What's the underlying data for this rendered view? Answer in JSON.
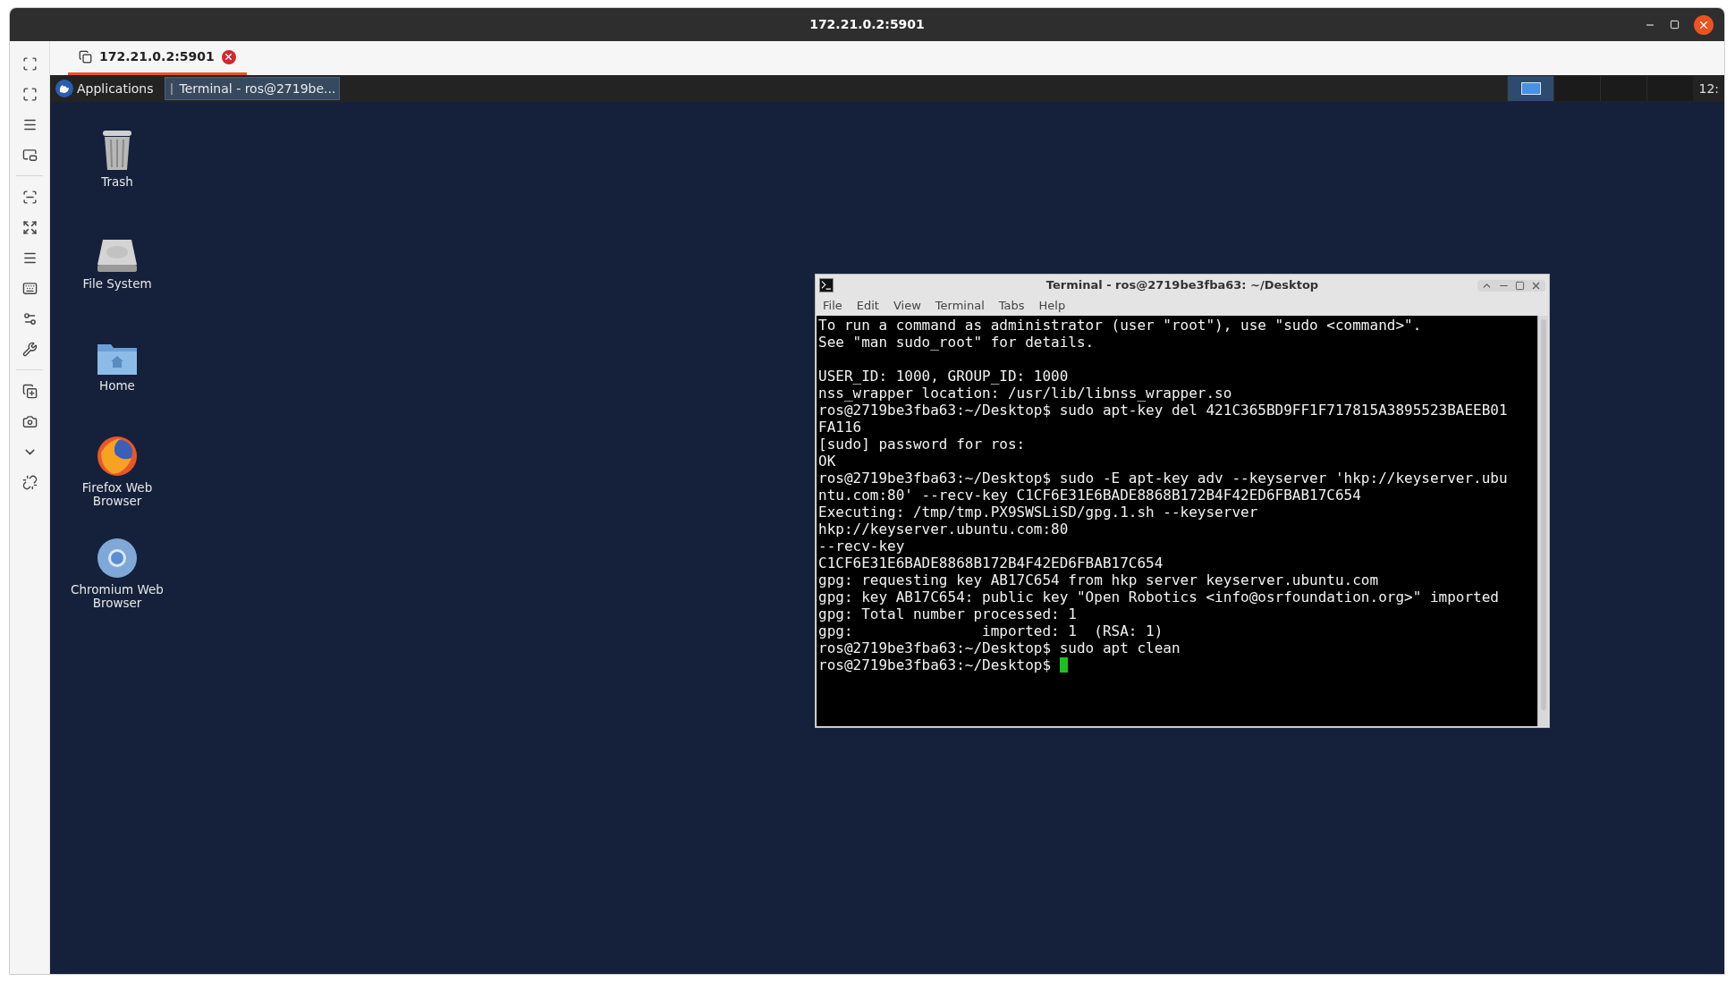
{
  "window": {
    "title": "172.21.0.2:5901"
  },
  "tabs": [
    {
      "label": "172.21.0.2:5901",
      "selected": true
    }
  ],
  "panel": {
    "applications_label": "Applications",
    "tasks": [
      {
        "label": "Terminal - ros@2719be...",
        "selected": true
      }
    ],
    "workspaces": [
      {
        "selected": true
      },
      {
        "selected": false
      },
      {
        "selected": false
      },
      {
        "selected": false
      }
    ],
    "clock": "12:"
  },
  "desktop_icons": [
    {
      "label": "Trash",
      "kind": "trash"
    },
    {
      "label": "File System",
      "kind": "drive"
    },
    {
      "label": "Home",
      "kind": "home"
    },
    {
      "label": "Firefox Web Browser",
      "kind": "firefox"
    },
    {
      "label": "Chromium Web Browser",
      "kind": "chromium"
    }
  ],
  "terminal": {
    "title": "Terminal - ros@2719be3fba63: ~/Desktop",
    "menu": [
      "File",
      "Edit",
      "View",
      "Terminal",
      "Tabs",
      "Help"
    ],
    "blocks": [
      [
        "To run a command as administrator (user \"root\"), use \"sudo <command>\".",
        "See \"man sudo_root\" for details."
      ],
      [
        "USER_ID: 1000, GROUP_ID: 1000",
        "nss_wrapper location: /usr/lib/libnss_wrapper.so",
        "ros@2719be3fba63:~/Desktop$ sudo apt-key del 421C365BD9FF1F717815A3895523BAEEB01",
        "FA116",
        "[sudo] password for ros:",
        "OK",
        "ros@2719be3fba63:~/Desktop$ sudo -E apt-key adv --keyserver 'hkp://keyserver.ubu",
        "ntu.com:80' --recv-key C1CF6E31E6BADE8868B172B4F42ED6FBAB17C654",
        "Executing: /tmp/tmp.PX9SWSLiSD/gpg.1.sh --keyserver",
        "hkp://keyserver.ubuntu.com:80",
        "--recv-key",
        "C1CF6E31E6BADE8868B172B4F42ED6FBAB17C654",
        "gpg: requesting key AB17C654 from hkp server keyserver.ubuntu.com",
        "gpg: key AB17C654: public key \"Open Robotics <info@osrfoundation.org>\" imported",
        "gpg: Total number processed: 1",
        "gpg:               imported: 1  (RSA: 1)",
        "ros@2719be3fba63:~/Desktop$ sudo apt clean"
      ]
    ],
    "prompt": "ros@2719be3fba63:~/Desktop$ "
  }
}
